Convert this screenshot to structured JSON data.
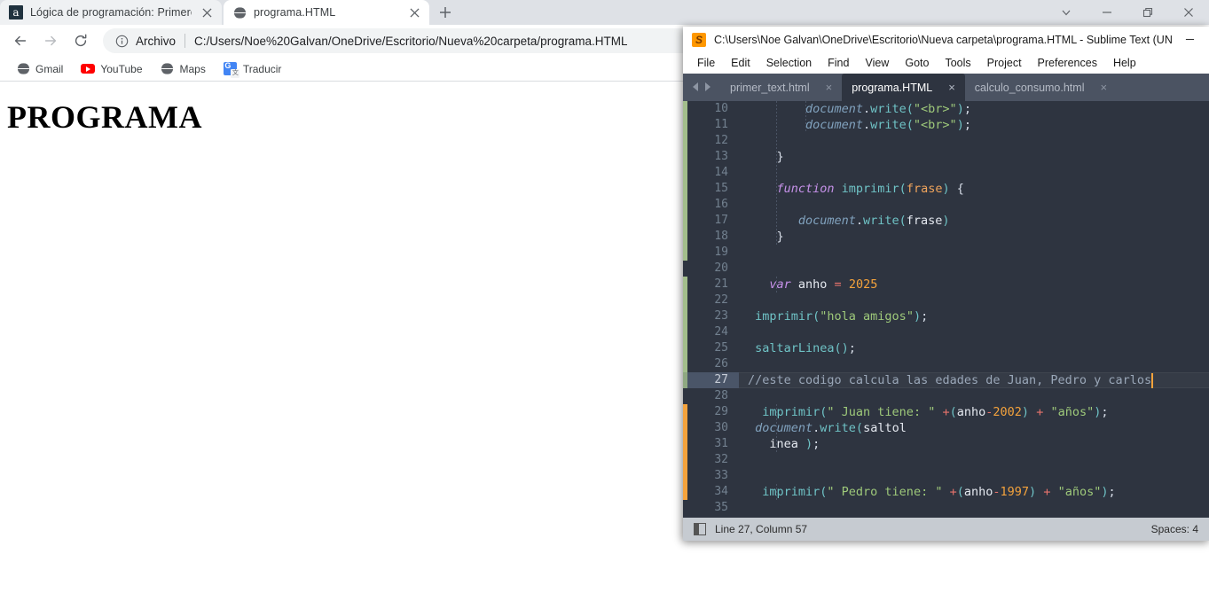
{
  "browser": {
    "tabs": [
      {
        "title": "Lógica de programación: Primero",
        "favicon": "letter-a-icon",
        "active": false
      },
      {
        "title": "programa.HTML",
        "favicon": "globe-icon",
        "active": true
      }
    ],
    "new_tab_label": "+",
    "window_controls": [
      "chevron-down-icon",
      "minimize-icon",
      "restore-icon",
      "close-icon"
    ],
    "toolbar": {
      "back": "back-arrow-icon",
      "forward": "forward-arrow-icon",
      "reload": "reload-icon",
      "info": "info-circle-icon",
      "scheme_label": "Archivo",
      "url": "C:/Users/Noe%20Galvan/OneDrive/Escritorio/Nueva%20carpeta/programa.HTML"
    },
    "bookmarks": [
      {
        "label": "Gmail",
        "icon": "globe-icon"
      },
      {
        "label": "YouTube",
        "icon": "youtube-icon"
      },
      {
        "label": "Maps",
        "icon": "globe-icon"
      },
      {
        "label": "Traducir",
        "icon": "translate-icon"
      }
    ],
    "page": {
      "heading": "PROGRAMA"
    }
  },
  "sublime": {
    "title": "C:\\Users\\Noe Galvan\\OneDrive\\Escritorio\\Nueva carpeta\\programa.HTML - Sublime Text (UNR...",
    "logo": "sublime-logo-icon",
    "minimize": "minimize-icon",
    "menu": [
      "File",
      "Edit",
      "Selection",
      "Find",
      "View",
      "Goto",
      "Tools",
      "Project",
      "Preferences",
      "Help"
    ],
    "tab_nav": {
      "prev": "chevron-left-icon",
      "next": "chevron-right-icon"
    },
    "tabs": [
      {
        "label": "primer_text.html",
        "close": "×",
        "active": false
      },
      {
        "label": "programa.HTML",
        "close": "×",
        "active": true
      },
      {
        "label": "calculo_consumo.html",
        "close": "×",
        "active": false
      }
    ],
    "first_line_number": 10,
    "cursor_line": 27,
    "lines": [
      {
        "n": 10,
        "indent": 8,
        "tokens": [
          {
            "t": "document",
            "c": "c-obj"
          },
          {
            "t": ".",
            "c": "c-punc"
          },
          {
            "t": "write",
            "c": "c-prop"
          },
          {
            "t": "(",
            "c": "c-paren"
          },
          {
            "t": "\"<br>\"",
            "c": "c-str"
          },
          {
            "t": ")",
            "c": "c-paren"
          },
          {
            "t": ";",
            "c": "c-punc"
          }
        ]
      },
      {
        "n": 11,
        "indent": 8,
        "tokens": [
          {
            "t": "document",
            "c": "c-obj"
          },
          {
            "t": ".",
            "c": "c-punc"
          },
          {
            "t": "write",
            "c": "c-prop"
          },
          {
            "t": "(",
            "c": "c-paren"
          },
          {
            "t": "\"<br>\"",
            "c": "c-str"
          },
          {
            "t": ")",
            "c": "c-paren"
          },
          {
            "t": ";",
            "c": "c-punc"
          }
        ]
      },
      {
        "n": 12,
        "indent": 0,
        "tokens": []
      },
      {
        "n": 13,
        "indent": 4,
        "tokens": [
          {
            "t": "}",
            "c": "c-punc"
          }
        ]
      },
      {
        "n": 14,
        "indent": 0,
        "tokens": []
      },
      {
        "n": 15,
        "indent": 4,
        "tokens": [
          {
            "t": "function",
            "c": "c-kw"
          },
          {
            "t": " ",
            "c": "c-plain"
          },
          {
            "t": "imprimir",
            "c": "c-prop"
          },
          {
            "t": "(",
            "c": "c-paren"
          },
          {
            "t": "frase",
            "c": "c-param"
          },
          {
            "t": ")",
            "c": "c-paren"
          },
          {
            "t": " {",
            "c": "c-punc"
          }
        ]
      },
      {
        "n": 16,
        "indent": 0,
        "tokens": []
      },
      {
        "n": 17,
        "indent": 7,
        "tokens": [
          {
            "t": "document",
            "c": "c-obj"
          },
          {
            "t": ".",
            "c": "c-punc"
          },
          {
            "t": "write",
            "c": "c-prop"
          },
          {
            "t": "(",
            "c": "c-paren"
          },
          {
            "t": "frase",
            "c": "c-plain"
          },
          {
            "t": ")",
            "c": "c-paren"
          }
        ]
      },
      {
        "n": 18,
        "indent": 4,
        "tokens": [
          {
            "t": "}",
            "c": "c-punc"
          }
        ]
      },
      {
        "n": 19,
        "indent": 0,
        "tokens": []
      },
      {
        "n": 20,
        "indent": 0,
        "tokens": []
      },
      {
        "n": 21,
        "indent": 3,
        "tokens": [
          {
            "t": "var",
            "c": "c-kw"
          },
          {
            "t": " anho ",
            "c": "c-plain"
          },
          {
            "t": "=",
            "c": "c-op"
          },
          {
            "t": " ",
            "c": "c-plain"
          },
          {
            "t": "2025",
            "c": "c-num"
          }
        ]
      },
      {
        "n": 22,
        "indent": 0,
        "tokens": []
      },
      {
        "n": 23,
        "indent": 1,
        "tokens": [
          {
            "t": "imprimir",
            "c": "c-call"
          },
          {
            "t": "(",
            "c": "c-paren"
          },
          {
            "t": "\"hola amigos\"",
            "c": "c-str"
          },
          {
            "t": ")",
            "c": "c-paren"
          },
          {
            "t": ";",
            "c": "c-punc"
          }
        ]
      },
      {
        "n": 24,
        "indent": 0,
        "tokens": []
      },
      {
        "n": 25,
        "indent": 1,
        "tokens": [
          {
            "t": "saltarLinea",
            "c": "c-call"
          },
          {
            "t": "()",
            "c": "c-paren"
          },
          {
            "t": ";",
            "c": "c-punc"
          }
        ]
      },
      {
        "n": 26,
        "indent": 0,
        "tokens": []
      },
      {
        "n": 27,
        "indent": 0,
        "current": true,
        "tokens": [
          {
            "t": "//este codigo calcula las edades de Juan, Pedro y carlos",
            "c": "c-cmt"
          }
        ]
      },
      {
        "n": 28,
        "indent": 0,
        "tokens": []
      },
      {
        "n": 29,
        "indent": 2,
        "tokens": [
          {
            "t": "imprimir",
            "c": "c-call"
          },
          {
            "t": "(",
            "c": "c-paren"
          },
          {
            "t": "\" Juan tiene: \"",
            "c": "c-str"
          },
          {
            "t": " ",
            "c": "c-plain"
          },
          {
            "t": "+",
            "c": "c-op"
          },
          {
            "t": "(",
            "c": "c-paren"
          },
          {
            "t": "anho",
            "c": "c-plain"
          },
          {
            "t": "-",
            "c": "c-op"
          },
          {
            "t": "2002",
            "c": "c-num"
          },
          {
            "t": ")",
            "c": "c-paren"
          },
          {
            "t": " ",
            "c": "c-plain"
          },
          {
            "t": "+",
            "c": "c-op"
          },
          {
            "t": " ",
            "c": "c-plain"
          },
          {
            "t": "\"años\"",
            "c": "c-str"
          },
          {
            "t": ")",
            "c": "c-paren"
          },
          {
            "t": ";",
            "c": "c-punc"
          }
        ]
      },
      {
        "n": 30,
        "indent": 1,
        "tokens": [
          {
            "t": "document",
            "c": "c-obj"
          },
          {
            "t": ".",
            "c": "c-punc"
          },
          {
            "t": "write",
            "c": "c-prop"
          },
          {
            "t": "(",
            "c": "c-paren"
          },
          {
            "t": "saltol",
            "c": "c-plain"
          }
        ]
      },
      {
        "n": 31,
        "indent": 3,
        "tokens": [
          {
            "t": "inea ",
            "c": "c-plain"
          },
          {
            "t": ")",
            "c": "c-paren"
          },
          {
            "t": ";",
            "c": "c-punc"
          }
        ]
      },
      {
        "n": 32,
        "indent": 0,
        "tokens": []
      },
      {
        "n": 33,
        "indent": 0,
        "tokens": []
      },
      {
        "n": 34,
        "indent": 2,
        "tokens": [
          {
            "t": "imprimir",
            "c": "c-call"
          },
          {
            "t": "(",
            "c": "c-paren"
          },
          {
            "t": "\" Pedro tiene: \"",
            "c": "c-str"
          },
          {
            "t": " ",
            "c": "c-plain"
          },
          {
            "t": "+",
            "c": "c-op"
          },
          {
            "t": "(",
            "c": "c-paren"
          },
          {
            "t": "anho",
            "c": "c-plain"
          },
          {
            "t": "-",
            "c": "c-op"
          },
          {
            "t": "1997",
            "c": "c-num"
          },
          {
            "t": ")",
            "c": "c-paren"
          },
          {
            "t": " ",
            "c": "c-plain"
          },
          {
            "t": "+",
            "c": "c-op"
          },
          {
            "t": " ",
            "c": "c-plain"
          },
          {
            "t": "\"años\"",
            "c": "c-str"
          },
          {
            "t": ")",
            "c": "c-paren"
          },
          {
            "t": ";",
            "c": "c-punc"
          }
        ]
      },
      {
        "n": 35,
        "indent": 0,
        "tokens": []
      }
    ],
    "gutter_markers": [
      {
        "from_line": 10,
        "to_line": 19,
        "color": "#a3be8c"
      },
      {
        "from_line": 21,
        "to_line": 26,
        "color": "#a3be8c"
      },
      {
        "from_line": 27,
        "to_line": 27,
        "color": "#8fa882"
      },
      {
        "from_line": 29,
        "to_line": 34,
        "color": "#f5a33c"
      }
    ],
    "statusbar": {
      "icon": "sidebar-toggle-icon",
      "position": "Line 27, Column 57",
      "indent": "Spaces: 4"
    }
  },
  "colors": {
    "editor_bg": "#2e3440",
    "tabbar_bg": "#4b5362",
    "status_bg": "#c6cbd1",
    "caret": "#f5a33c",
    "browser_chrome": "#dee1e6"
  }
}
